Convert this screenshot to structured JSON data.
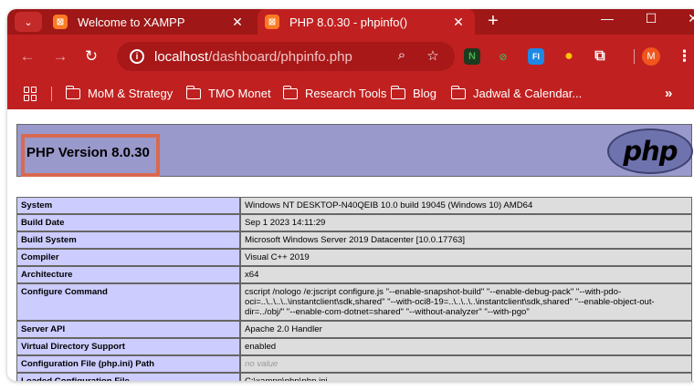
{
  "browser": {
    "tabs": [
      {
        "title": "Welcome to XAMPP",
        "icon": "xampp-icon",
        "active": false
      },
      {
        "title": "PHP 8.0.30 - phpinfo()",
        "icon": "xampp-icon",
        "active": true
      }
    ],
    "tab_close_glyph": "✕",
    "new_tab_glyph": "+",
    "url": {
      "host": "localhost",
      "path": "/dashboard/phpinfo.php"
    },
    "extensions": [
      {
        "name": "n-extension-icon",
        "label": "N",
        "color": "#2e7d32"
      },
      {
        "name": "eye-slash-extension-icon",
        "label": "⊘",
        "color": "#4caf50"
      },
      {
        "name": "fi-extension-icon",
        "label": "FI",
        "color": "#1e88e5"
      },
      {
        "name": "yellow-dot-extension-icon",
        "label": "●",
        "color": "#ffc107"
      }
    ],
    "profile_initial": "M",
    "bookmarks": [
      "MoM & Strategy",
      "TMO Monet",
      "Research Tools",
      "Blog",
      "Jadwal & Calendar..."
    ],
    "bookmarks_more": "»"
  },
  "page": {
    "php_version": "PHP Version 8.0.30",
    "logo_text": "php",
    "rows": [
      {
        "key": "System",
        "value": "Windows NT DESKTOP-N40QEIB 10.0 build 19045 (Windows 10) AMD64",
        "novalue": false
      },
      {
        "key": "Build Date",
        "value": "Sep 1 2023 14:11:29",
        "novalue": false
      },
      {
        "key": "Build System",
        "value": "Microsoft Windows Server 2019 Datacenter [10.0.17763]",
        "novalue": false
      },
      {
        "key": "Compiler",
        "value": "Visual C++ 2019",
        "novalue": false
      },
      {
        "key": "Architecture",
        "value": "x64",
        "novalue": false
      },
      {
        "key": "Configure Command",
        "value": "cscript /nologo /e:jscript configure.js \"--enable-snapshot-build\" \"--enable-debug-pack\" \"--with-pdo-oci=..\\..\\..\\..\\instantclient\\sdk,shared\" \"--with-oci8-19=..\\..\\..\\..\\instantclient\\sdk,shared\" \"--enable-object-out-dir=../obj/\" \"--enable-com-dotnet=shared\" \"--without-analyzer\" \"--with-pgo\"",
        "novalue": false
      },
      {
        "key": "Server API",
        "value": "Apache 2.0 Handler",
        "novalue": false
      },
      {
        "key": "Virtual Directory Support",
        "value": "enabled",
        "novalue": false
      },
      {
        "key": "Configuration File (php.ini) Path",
        "value": "no value",
        "novalue": true
      },
      {
        "key": "Loaded Configuration File",
        "value": "C:\\xampp\\php\\php.ini",
        "novalue": false
      }
    ]
  },
  "colors": {
    "chrome_dark": "#9f1717",
    "chrome": "#c12020",
    "php_header": "#9999cc",
    "key_cell": "#ccccff",
    "value_cell": "#dddddd",
    "highlight": "#d9694f"
  }
}
